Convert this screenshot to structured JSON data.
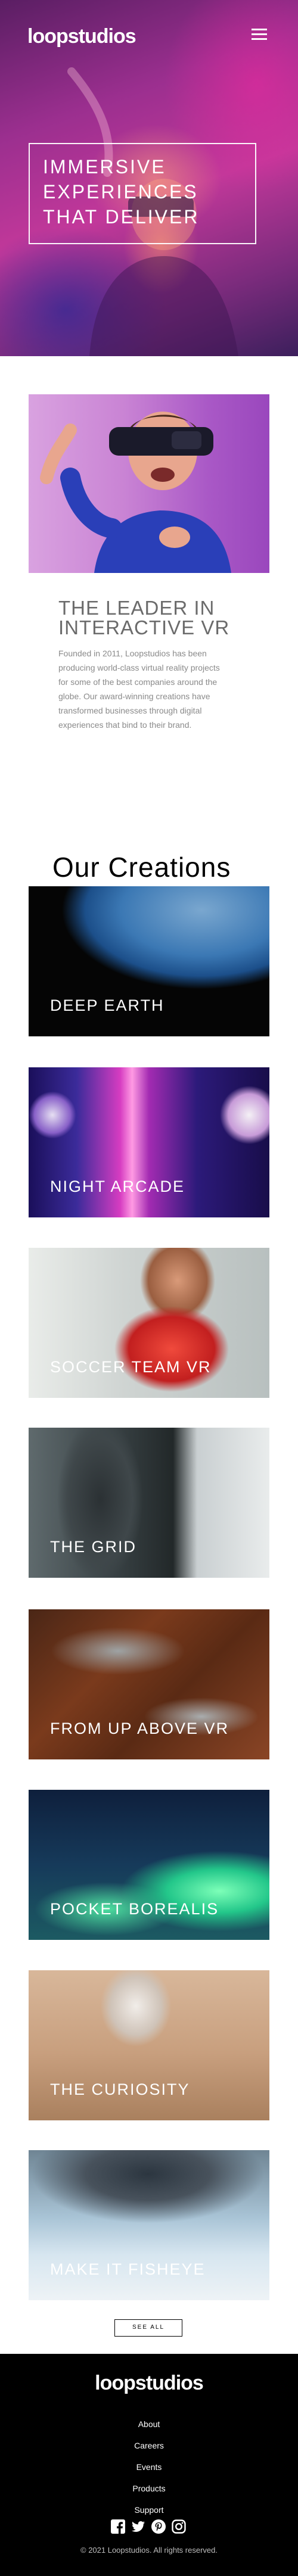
{
  "header": {
    "logo": "loopstudios",
    "menu_icon": "hamburger-menu-icon"
  },
  "hero": {
    "lines": [
      "IMMERSIVE",
      "EXPERIENCES",
      "THAT DELIVER"
    ]
  },
  "intro": {
    "title_lines": [
      "THE LEADER IN",
      "INTERACTIVE VR"
    ],
    "body": "Founded in 2011, Loopstudios has been producing world-class virtual reality projects for some of the best companies around the globe. Our award-winning creations have transformed businesses through digital experiences that bind to their brand."
  },
  "creations": {
    "title": "Our Creations",
    "items": [
      {
        "label": "DEEP EARTH"
      },
      {
        "label": "NIGHT ARCADE"
      },
      {
        "label": "SOCCER TEAM VR"
      },
      {
        "label": "THE GRID"
      },
      {
        "label": "FROM UP ABOVE VR"
      },
      {
        "label": "POCKET BOREALIS"
      },
      {
        "label": "THE CURIOSITY"
      },
      {
        "label": "MAKE IT FISHEYE"
      }
    ],
    "see_all": "SEE ALL"
  },
  "footer": {
    "logo": "loopstudios",
    "links": [
      "About",
      "Careers",
      "Events",
      "Products",
      "Support"
    ],
    "socials": [
      "facebook-icon",
      "twitter-icon",
      "pinterest-icon",
      "instagram-icon"
    ],
    "copyright": "© 2021 Loopstudios. All rights reserved."
  },
  "colors": {
    "background": "#ffffff",
    "text": "#000000",
    "muted_text": "#8a8a8a",
    "footer_background": "#000000",
    "hero_accent": "#c2389a"
  }
}
